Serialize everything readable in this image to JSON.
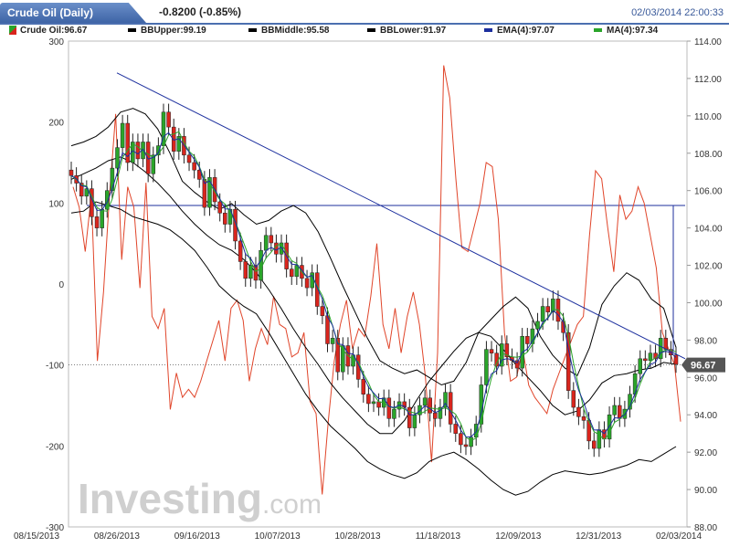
{
  "header": {
    "title": "Crude Oil (Daily)",
    "change": "-0.8200 (-0.85%)",
    "timestamp": "02/03/2014 22:00:33"
  },
  "legend": {
    "items": [
      {
        "label": "Crude Oil:96.67",
        "color": "#2aa52a"
      },
      {
        "label": "BBUpper:99.19",
        "color": "#000000"
      },
      {
        "label": "BBMiddle:95.58",
        "color": "#000000"
      },
      {
        "label": "BBLower:91.97",
        "color": "#000000"
      },
      {
        "label": "EMA(4):97.07",
        "color": "#1c2f9e"
      },
      {
        "label": "MA(4):97.34",
        "color": "#2aa52a"
      }
    ]
  },
  "watermark": {
    "brand": "Investing",
    "suffix": ".com"
  },
  "price_tag": "96.67",
  "chart_data": {
    "type": "candlestick",
    "x_tick_labels": [
      "08/15/2013",
      "08/26/2013",
      "09/16/2013",
      "10/07/2013",
      "10/28/2013",
      "11/18/2013",
      "12/09/2013",
      "12/31/2013",
      "02/03/2014"
    ],
    "right_axis": {
      "ticks": [
        "114.00",
        "112.00",
        "110.00",
        "108.00",
        "106.00",
        "104.00",
        "102.00",
        "100.00",
        "98.00",
        "96.00",
        "94.00",
        "92.00",
        "90.00",
        "88.00"
      ],
      "ylim": [
        88,
        114
      ]
    },
    "left_axis": {
      "ticks": [
        "300",
        "200",
        "100",
        "0",
        "-100",
        "-200",
        "-300"
      ],
      "ylim": [
        -300,
        300
      ]
    },
    "last_price": 96.67,
    "horizontal_line": 105.2,
    "trend_line": {
      "start": {
        "x": "08/26/2013",
        "y": 112.3
      },
      "end": {
        "x": "02/03/2014",
        "y": 97.0
      }
    },
    "price_close": [
      106.8,
      106.4,
      105.7,
      106.1,
      104.6,
      104.0,
      105.0,
      106.0,
      107.2,
      108.3,
      109.6,
      107.5,
      108.6,
      107.7,
      108.6,
      106.9,
      107.9,
      108.4,
      110.2,
      109.4,
      108.1,
      108.9,
      107.9,
      107.5,
      107.1,
      106.6,
      105.1,
      106.7,
      105.4,
      104.8,
      104.2,
      105.0,
      103.3,
      102.2,
      101.3,
      102.0,
      101.2,
      102.8,
      103.6,
      103.2,
      102.6,
      103.2,
      101.8,
      101.4,
      102.0,
      101.3,
      100.8,
      101.6,
      99.8,
      99.3,
      97.8,
      98.1,
      96.3,
      97.7,
      96.6,
      97.2,
      95.9,
      95.1,
      94.6,
      94.7,
      94.4,
      94.9,
      93.8,
      94.3,
      94.7,
      94.4,
      93.3,
      94.0,
      94.5,
      94.9,
      94.1,
      93.8,
      94.4,
      95.2,
      93.5,
      93.0,
      92.4,
      92.3,
      92.8,
      93.5,
      95.6,
      97.5,
      97.3,
      96.6,
      97.8,
      97.1,
      96.9,
      96.5,
      98.2,
      97.8,
      98.6,
      99.0,
      99.8,
      99.5,
      100.2,
      99.0,
      98.4,
      95.3,
      94.4,
      93.9,
      93.7,
      92.6,
      92.2,
      93.2,
      92.7,
      94.0,
      94.5,
      93.8,
      94.3,
      95.1,
      96.2,
      97.0,
      96.9,
      97.3,
      97.0,
      98.1,
      97.5,
      97.2,
      96.7
    ],
    "bb_upper": [
      108.4,
      108.6,
      108.9,
      109.4,
      110.2,
      110.4,
      110.1,
      109.3,
      108.0,
      106.5,
      105.9,
      105.4,
      105.0,
      105.3,
      104.7,
      104.2,
      104.4,
      104.9,
      105.2,
      104.8,
      103.8,
      102.4,
      100.9,
      99.5,
      98.1,
      96.9,
      96.5,
      96.2,
      96.4,
      96.0,
      95.6,
      95.8,
      96.8,
      98.4,
      99.1,
      99.8,
      100.3,
      99.7,
      98.2,
      97.2,
      96.5,
      96.1,
      97.6,
      99.9,
      100.9,
      101.6,
      101.2,
      100.2,
      99.7,
      97.6
    ],
    "bb_middle": [
      106.6,
      106.9,
      107.2,
      107.6,
      107.8,
      107.5,
      107.0,
      106.4,
      105.7,
      104.9,
      104.2,
      103.6,
      103.1,
      102.8,
      102.3,
      101.6,
      100.7,
      99.7,
      98.6,
      97.6,
      96.7,
      95.7,
      94.9,
      94.2,
      93.5,
      93.0,
      93.0,
      93.7,
      94.8,
      95.8,
      96.6,
      97.4,
      98.1,
      98.4,
      98.2,
      97.5,
      96.7,
      96.0,
      95.3,
      94.5,
      94.0,
      94.2,
      94.8,
      95.7,
      96.1,
      96.2,
      96.4,
      96.5,
      96.8,
      96.7
    ],
    "bb_lower": [
      104.8,
      104.9,
      105.4,
      105.2,
      105.0,
      104.6,
      104.4,
      104.2,
      103.9,
      103.4,
      102.8,
      101.9,
      100.9,
      100.3,
      99.8,
      99.4,
      98.4,
      97.3,
      96.2,
      95.1,
      94.2,
      93.4,
      92.8,
      92.2,
      91.5,
      91.1,
      90.8,
      90.6,
      90.9,
      91.5,
      91.8,
      92.0,
      91.6,
      91.1,
      90.5,
      90.0,
      89.7,
      89.9,
      90.4,
      90.8,
      91.0,
      90.9,
      90.8,
      90.9,
      91.1,
      91.3,
      91.6,
      91.5,
      91.9,
      92.3
    ],
    "oscillator": [
      120,
      95,
      40,
      110,
      -95,
      -10,
      110,
      210,
      30,
      120,
      95,
      -5,
      125,
      -40,
      -55,
      -30,
      -155,
      -110,
      -140,
      -130,
      -140,
      -120,
      -95,
      -70,
      -45,
      -95,
      -30,
      -20,
      -45,
      -120,
      -80,
      -55,
      -75,
      -15,
      -50,
      -55,
      -90,
      -85,
      -60,
      -145,
      -160,
      -260,
      -170,
      -95,
      -50,
      -20,
      -80,
      -55,
      -65,
      -15,
      50,
      -50,
      -80,
      -30,
      -85,
      -40,
      -10,
      -50,
      -115,
      -220,
      -85,
      270,
      230,
      130,
      45,
      40,
      70,
      100,
      150,
      145,
      80,
      -60,
      -120,
      -115,
      -80,
      -125,
      -140,
      -150,
      -160,
      -130,
      -110,
      -90,
      -70,
      -50,
      -40,
      60,
      140,
      130,
      70,
      15,
      110,
      80,
      90,
      120,
      100,
      60,
      20,
      -60,
      -80,
      -100,
      -170
    ]
  }
}
